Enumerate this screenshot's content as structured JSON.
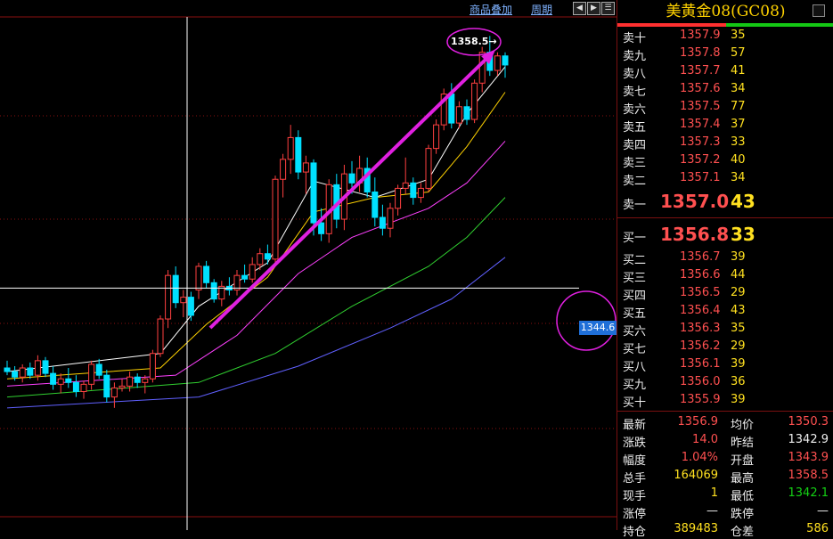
{
  "toolbar": {
    "overlay_link": "商品叠加",
    "period_link": "周期"
  },
  "chart": {
    "peak_label": "1358.5→",
    "price_tag": "1344.6",
    "colors": {
      "up": "#ff4040",
      "down": "#00e0ff",
      "ma5": "#ffffff",
      "ma10": "#ffd200",
      "ma20": "#ff40ff",
      "ma40": "#30d030",
      "ma60": "#6060ff",
      "arrow": "#e020e0"
    }
  },
  "chart_data": {
    "type": "candlestick",
    "candles": [
      [
        1340.2,
        1340.6,
        1339.8,
        1340.0
      ],
      [
        1340.0,
        1340.3,
        1339.5,
        1339.7
      ],
      [
        1339.7,
        1340.4,
        1339.4,
        1340.2
      ],
      [
        1340.2,
        1340.5,
        1339.6,
        1339.8
      ],
      [
        1339.8,
        1340.9,
        1339.5,
        1340.6
      ],
      [
        1340.6,
        1340.8,
        1339.7,
        1339.9
      ],
      [
        1339.9,
        1340.3,
        1339.0,
        1339.3
      ],
      [
        1339.3,
        1339.9,
        1338.8,
        1339.6
      ],
      [
        1339.6,
        1340.2,
        1339.1,
        1339.4
      ],
      [
        1339.4,
        1339.8,
        1338.6,
        1338.9
      ],
      [
        1338.9,
        1339.5,
        1338.5,
        1339.3
      ],
      [
        1339.3,
        1340.6,
        1339.0,
        1340.4
      ],
      [
        1340.4,
        1340.7,
        1339.6,
        1339.8
      ],
      [
        1339.8,
        1340.1,
        1338.3,
        1338.6
      ],
      [
        1338.6,
        1339.4,
        1338.0,
        1339.1
      ],
      [
        1339.1,
        1339.6,
        1338.9,
        1339.2
      ],
      [
        1339.2,
        1340.0,
        1338.9,
        1339.7
      ],
      [
        1339.7,
        1339.9,
        1339.1,
        1339.4
      ],
      [
        1339.4,
        1339.8,
        1338.8,
        1339.6
      ],
      [
        1339.6,
        1341.2,
        1339.4,
        1341.0
      ],
      [
        1341.0,
        1343.1,
        1340.8,
        1342.9
      ],
      [
        1342.9,
        1345.6,
        1342.4,
        1345.3
      ],
      [
        1345.3,
        1345.8,
        1343.5,
        1343.8
      ],
      [
        1343.8,
        1344.5,
        1343.0,
        1344.1
      ],
      [
        1344.1,
        1344.4,
        1342.8,
        1343.1
      ],
      [
        1344.5,
        1346.0,
        1344.0,
        1345.8
      ],
      [
        1345.8,
        1346.1,
        1344.6,
        1344.9
      ],
      [
        1344.9,
        1345.1,
        1343.8,
        1344.0
      ],
      [
        1344.0,
        1345.0,
        1343.6,
        1344.7
      ],
      [
        1344.7,
        1345.2,
        1344.2,
        1344.5
      ],
      [
        1344.5,
        1345.6,
        1344.2,
        1345.3
      ],
      [
        1345.3,
        1345.9,
        1344.9,
        1345.1
      ],
      [
        1345.1,
        1346.3,
        1344.9,
        1345.9
      ],
      [
        1345.9,
        1346.8,
        1345.6,
        1346.5
      ],
      [
        1346.5,
        1347.0,
        1345.9,
        1346.2
      ],
      [
        1346.2,
        1350.8,
        1345.9,
        1350.6
      ],
      [
        1350.6,
        1352.0,
        1349.6,
        1351.7
      ],
      [
        1351.7,
        1353.6,
        1350.9,
        1352.9
      ],
      [
        1352.9,
        1353.3,
        1350.6,
        1351.0
      ],
      [
        1351.0,
        1351.9,
        1349.8,
        1351.5
      ],
      [
        1351.5,
        1351.7,
        1347.5,
        1348.2
      ],
      [
        1348.2,
        1349.0,
        1347.2,
        1347.6
      ],
      [
        1347.6,
        1350.6,
        1347.1,
        1350.3
      ],
      [
        1350.3,
        1350.9,
        1347.9,
        1348.4
      ],
      [
        1348.4,
        1351.4,
        1347.8,
        1350.9
      ],
      [
        1350.9,
        1351.6,
        1349.8,
        1350.4
      ],
      [
        1350.4,
        1351.9,
        1349.9,
        1351.2
      ],
      [
        1351.2,
        1351.8,
        1349.6,
        1349.9
      ],
      [
        1349.9,
        1350.7,
        1348.0,
        1348.5
      ],
      [
        1348.5,
        1349.2,
        1347.5,
        1347.9
      ],
      [
        1347.9,
        1349.3,
        1347.4,
        1349.0
      ],
      [
        1349.0,
        1350.3,
        1348.6,
        1350.1
      ],
      [
        1350.1,
        1351.8,
        1349.8,
        1350.4
      ],
      [
        1350.4,
        1350.7,
        1349.2,
        1349.6
      ],
      [
        1349.6,
        1350.4,
        1349.3,
        1350.1
      ],
      [
        1350.1,
        1352.5,
        1349.9,
        1352.3
      ],
      [
        1352.3,
        1353.9,
        1352.0,
        1353.6
      ],
      [
        1353.6,
        1355.6,
        1353.3,
        1355.3
      ],
      [
        1355.3,
        1355.9,
        1353.4,
        1353.7
      ],
      [
        1353.7,
        1354.9,
        1353.4,
        1354.6
      ],
      [
        1354.6,
        1355.0,
        1353.6,
        1353.9
      ],
      [
        1353.9,
        1356.1,
        1353.7,
        1355.9
      ],
      [
        1355.9,
        1357.9,
        1355.4,
        1357.6
      ],
      [
        1357.6,
        1358.5,
        1356.3,
        1356.6
      ],
      [
        1356.6,
        1357.6,
        1356.3,
        1357.4
      ],
      [
        1357.4,
        1357.6,
        1356.2,
        1356.9
      ]
    ],
    "ma": {
      "ma5": [
        [
          0,
          1340.0
        ],
        [
          20,
          1341.0
        ],
        [
          25,
          1343.6
        ],
        [
          34,
          1346.0
        ],
        [
          40,
          1350.5
        ],
        [
          48,
          1349.6
        ],
        [
          55,
          1350.6
        ],
        [
          60,
          1354.2
        ],
        [
          65,
          1356.8
        ]
      ],
      "ma10": [
        [
          0,
          1339.6
        ],
        [
          20,
          1340.2
        ],
        [
          26,
          1342.6
        ],
        [
          34,
          1345.2
        ],
        [
          40,
          1348.8
        ],
        [
          48,
          1349.6
        ],
        [
          55,
          1349.9
        ],
        [
          60,
          1352.4
        ],
        [
          65,
          1355.4
        ]
      ],
      "ma20": [
        [
          0,
          1339.2
        ],
        [
          22,
          1339.8
        ],
        [
          30,
          1342.0
        ],
        [
          38,
          1345.4
        ],
        [
          45,
          1347.4
        ],
        [
          55,
          1349.0
        ],
        [
          60,
          1350.4
        ],
        [
          65,
          1352.7
        ]
      ],
      "ma40": [
        [
          0,
          1338.6
        ],
        [
          25,
          1339.4
        ],
        [
          35,
          1341.0
        ],
        [
          45,
          1343.6
        ],
        [
          55,
          1345.8
        ],
        [
          60,
          1347.4
        ],
        [
          65,
          1349.6
        ]
      ],
      "ma60": [
        [
          0,
          1338.0
        ],
        [
          25,
          1338.6
        ],
        [
          38,
          1340.3
        ],
        [
          50,
          1342.4
        ],
        [
          58,
          1344.0
        ],
        [
          65,
          1346.3
        ]
      ]
    },
    "ylim": [
      1332.0,
      1359.5
    ]
  },
  "panel": {
    "title": "美黄金08(GC08)",
    "asks": [
      {
        "label": "卖十",
        "price": "1357.9",
        "vol": "35"
      },
      {
        "label": "卖九",
        "price": "1357.8",
        "vol": "57"
      },
      {
        "label": "卖八",
        "price": "1357.7",
        "vol": "41"
      },
      {
        "label": "卖七",
        "price": "1357.6",
        "vol": "34"
      },
      {
        "label": "卖六",
        "price": "1357.5",
        "vol": "77"
      },
      {
        "label": "卖五",
        "price": "1357.4",
        "vol": "37"
      },
      {
        "label": "卖四",
        "price": "1357.3",
        "vol": "33"
      },
      {
        "label": "卖三",
        "price": "1357.2",
        "vol": "40"
      },
      {
        "label": "卖二",
        "price": "1357.1",
        "vol": "34"
      },
      {
        "label": "卖一",
        "price": "1357.0",
        "vol": "43"
      }
    ],
    "bids": [
      {
        "label": "买一",
        "price": "1356.8",
        "vol": "33"
      },
      {
        "label": "买二",
        "price": "1356.7",
        "vol": "39"
      },
      {
        "label": "买三",
        "price": "1356.6",
        "vol": "44"
      },
      {
        "label": "买四",
        "price": "1356.5",
        "vol": "29"
      },
      {
        "label": "买五",
        "price": "1356.4",
        "vol": "43"
      },
      {
        "label": "买六",
        "price": "1356.3",
        "vol": "35"
      },
      {
        "label": "买七",
        "price": "1356.2",
        "vol": "29"
      },
      {
        "label": "买八",
        "price": "1356.1",
        "vol": "39"
      },
      {
        "label": "买九",
        "price": "1356.0",
        "vol": "36"
      },
      {
        "label": "买十",
        "price": "1355.9",
        "vol": "39"
      }
    ],
    "stats": [
      {
        "l1": "最新",
        "v1": "1356.9",
        "c1": "red",
        "l2": "均价",
        "v2": "1350.3",
        "c2": "red"
      },
      {
        "l1": "涨跌",
        "v1": "14.0",
        "c1": "red",
        "l2": "昨结",
        "v2": "1342.9",
        "c2": "wht"
      },
      {
        "l1": "幅度",
        "v1": "1.04%",
        "c1": "red",
        "l2": "开盘",
        "v2": "1343.9",
        "c2": "red"
      },
      {
        "l1": "总手",
        "v1": "164069",
        "c1": "yel",
        "l2": "最高",
        "v2": "1358.5",
        "c2": "red"
      },
      {
        "l1": "现手",
        "v1": "1",
        "c1": "yel",
        "l2": "最低",
        "v2": "1342.1",
        "c2": "grn"
      },
      {
        "l1": "涨停",
        "v1": "—",
        "c1": "wht",
        "l2": "跌停",
        "v2": "—",
        "c2": "wht"
      },
      {
        "l1": "持仓",
        "v1": "389483",
        "c1": "yel",
        "l2": "仓差",
        "v2": "586",
        "c2": "yel"
      }
    ]
  }
}
